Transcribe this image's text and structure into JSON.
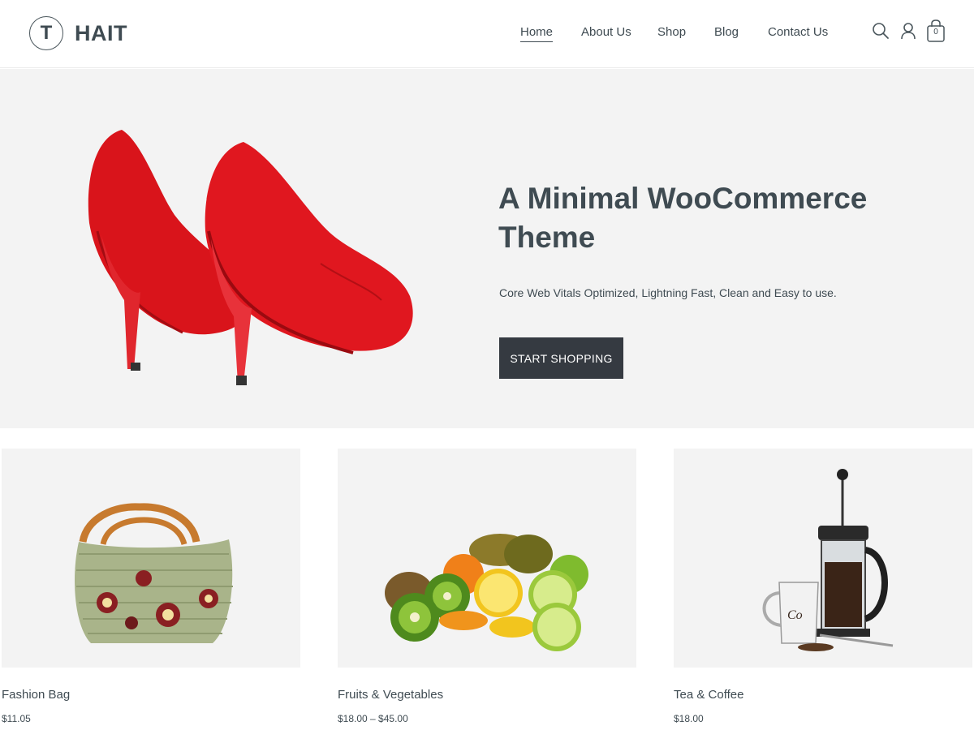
{
  "brand": {
    "logo_letter": "T",
    "name": "HAIT"
  },
  "nav": {
    "items": [
      {
        "label": "Home"
      },
      {
        "label": "About Us"
      },
      {
        "label": "Shop"
      },
      {
        "label": "Blog"
      },
      {
        "label": "Contact Us"
      }
    ],
    "active": "Home"
  },
  "header_icons": {
    "search": "search-icon",
    "account": "user-icon",
    "cart": "shopping-bag-icon",
    "cart_count": "0"
  },
  "hero": {
    "title": "A Minimal WooCommerce Theme",
    "subtitle": "Core Web Vitals Optimized, Lightning Fast, Clean and Easy to use.",
    "button_label": "START SHOPPING",
    "image": "red-high-heel-shoes"
  },
  "products": [
    {
      "name": "Fashion Bag",
      "price": "$11.05",
      "image": "woven-handbag"
    },
    {
      "name": "Fruits & Vegetables",
      "price": "$18.00 – $45.00",
      "image": "fruit-pile"
    },
    {
      "name": "Tea & Coffee",
      "price": "$18.00",
      "image": "french-press-coffee"
    }
  ],
  "colors": {
    "text": "#3f4b52",
    "hero_bg": "#f3f3f3",
    "button_bg": "#353a41",
    "shoe_red": "#d9141b"
  }
}
